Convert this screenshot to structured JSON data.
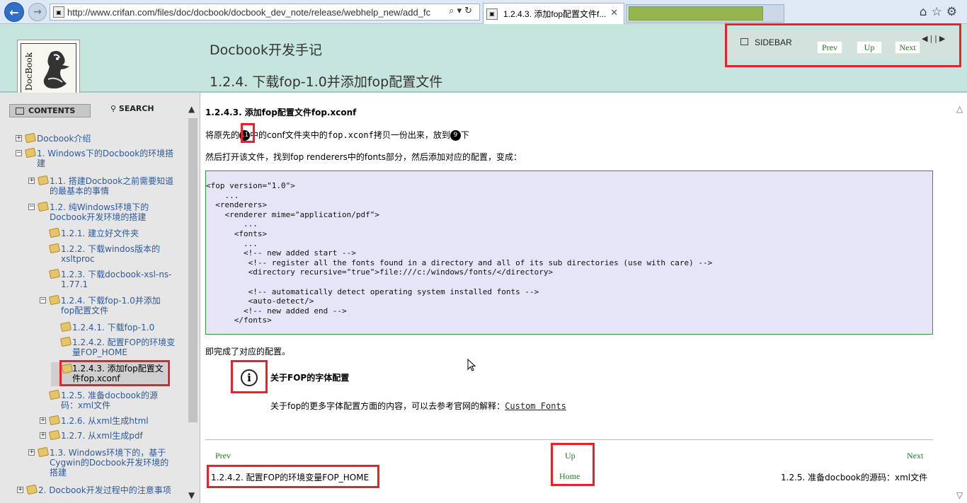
{
  "browser": {
    "url": "http://www.crifan.com/files/doc/docbook/docbook_dev_note/release/webhelp_new/add_fc",
    "active_tab_title": "1.2.4.3. 添加fop配置文件f...",
    "tab_close": "✕",
    "addr_icons": "⌕▾↻",
    "right_icons": "⌂☆⚙"
  },
  "header": {
    "doc_title": "Docbook开发手记",
    "page_title": "1.2.4. 下载fop-1.0并添加fop配置文件",
    "sidebar_label": "SIDEBAR",
    "prev": "Prev",
    "up": "Up",
    "next": "Next",
    "arrows": "◀||▶"
  },
  "sidebar": {
    "tab_contents": "CONTENTS",
    "tab_search": "SEARCH",
    "toc": [
      {
        "label": "Docbook介绍",
        "exp": "+"
      },
      {
        "label": "1. Windows下的Docbook的环境搭建",
        "exp": "−"
      },
      {
        "label": "1.1. 搭建Docbook之前需要知道的最基本的事情",
        "exp": "+"
      },
      {
        "label": "1.2. 纯Windows环境下的Docbook开发环境的搭建",
        "exp": "−"
      },
      {
        "label": "1.2.1. 建立好文件夹",
        "exp": ""
      },
      {
        "label": "1.2.2. 下载windos版本的xsltproc",
        "exp": ""
      },
      {
        "label": "1.2.3. 下载docbook-xsl-ns-1.77.1",
        "exp": ""
      },
      {
        "label": "1.2.4. 下载fop-1.0并添加fop配置文件",
        "exp": "−"
      },
      {
        "label": "1.2.4.1. 下载fop-1.0",
        "exp": ""
      },
      {
        "label": "1.2.4.2. 配置FOP的环境变量FOP_HOME",
        "exp": ""
      },
      {
        "label": "1.2.4.3. 添加fop配置文件fop.xconf",
        "exp": ""
      },
      {
        "label": "1.2.5. 准备docbook的源码：xml文件",
        "exp": ""
      },
      {
        "label": "1.2.6. 从xml生成html",
        "exp": "+"
      },
      {
        "label": "1.2.7. 从xml生成pdf",
        "exp": "+"
      },
      {
        "label": "1.3. Windows环境下的，基于Cygwin的Docbook开发环境的搭建",
        "exp": "+"
      },
      {
        "label": "2. Docbook开发过程中的注意事项",
        "exp": "+"
      }
    ],
    "scroll_up": "▲",
    "scroll_down": "▼"
  },
  "content": {
    "section_title": "1.2.4.3. 添加fop配置文件fop.xconf",
    "p1_a": "将原先的",
    "p1_num_a": "11",
    "p1_b": "中的conf文件夹中的",
    "p1_code": "fop.xconf",
    "p1_c": "拷贝一份出来，放到",
    "p1_num_b": "9",
    "p1_d": "下",
    "p2": "然后打开该文件，找到fop  renderers中的fonts部分，然后添加对应的配置，变成：",
    "code": "<fop version=\"1.0\">\n    ...\n  <renderers>\n    <renderer mime=\"application/pdf\">\n        ...\n      <fonts>\n        ...\n        <!-- new added start -->\n         <!-- register all the fonts found in a directory and all of its sub directories (use with care) -->\n         <directory recursive=\"true\">file:///c:/windows/fonts/</directory>\n\n         <!-- automatically detect operating system installed fonts -->\n         <auto-detect/>\n        <!-- new added end -->\n      </fonts>",
    "p3": "即完成了对应的配置。",
    "note_icon": "i",
    "note_title": "关于FOP的字体配置",
    "note_body": "关于fop的更多字体配置方面的内容，可以去参考官网的解释：",
    "note_link": "Custom Fonts",
    "footer": {
      "prev": "Prev",
      "up": "Up",
      "next": "Next",
      "home": "Home",
      "prev_title": "1.2.4.2. 配置FOP的环境变量FOP_HOME",
      "next_title": "1.2.5. 准备docbook的源码：xml文件"
    },
    "scroll_up": "△",
    "scroll_down": "▽"
  },
  "colors": {
    "header_bg": "#c7e5df",
    "highlight": "#e8212a",
    "nav_link": "#1f7a1f",
    "toc_link": "#2e5a9a"
  }
}
